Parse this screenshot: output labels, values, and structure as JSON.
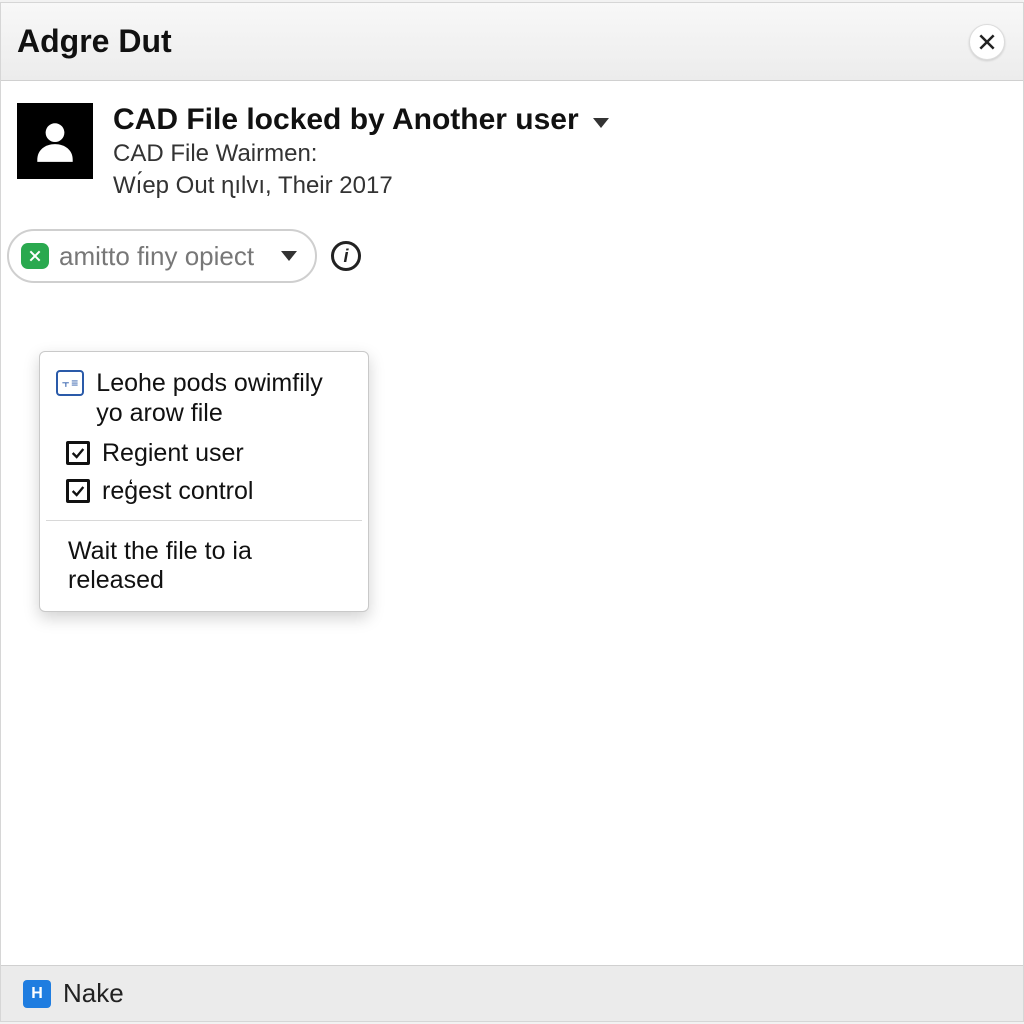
{
  "window": {
    "title": "Adgre Dut"
  },
  "header": {
    "title": "CAD File locked by Another user",
    "subtitle_line1": "CAD File Wairmen:",
    "subtitle_line2": "Wı́ep Out ɳılvı, Their 2017"
  },
  "combo": {
    "placeholder": "amitto finy opiect"
  },
  "dropdown": {
    "item1": "Leohe рods owimfily yo arow file",
    "item2": "Regient user",
    "item3": "reģest control",
    "footer": "Wait the file to ia released"
  },
  "statusbar": {
    "label": "Nake",
    "icon_glyph": "H"
  }
}
